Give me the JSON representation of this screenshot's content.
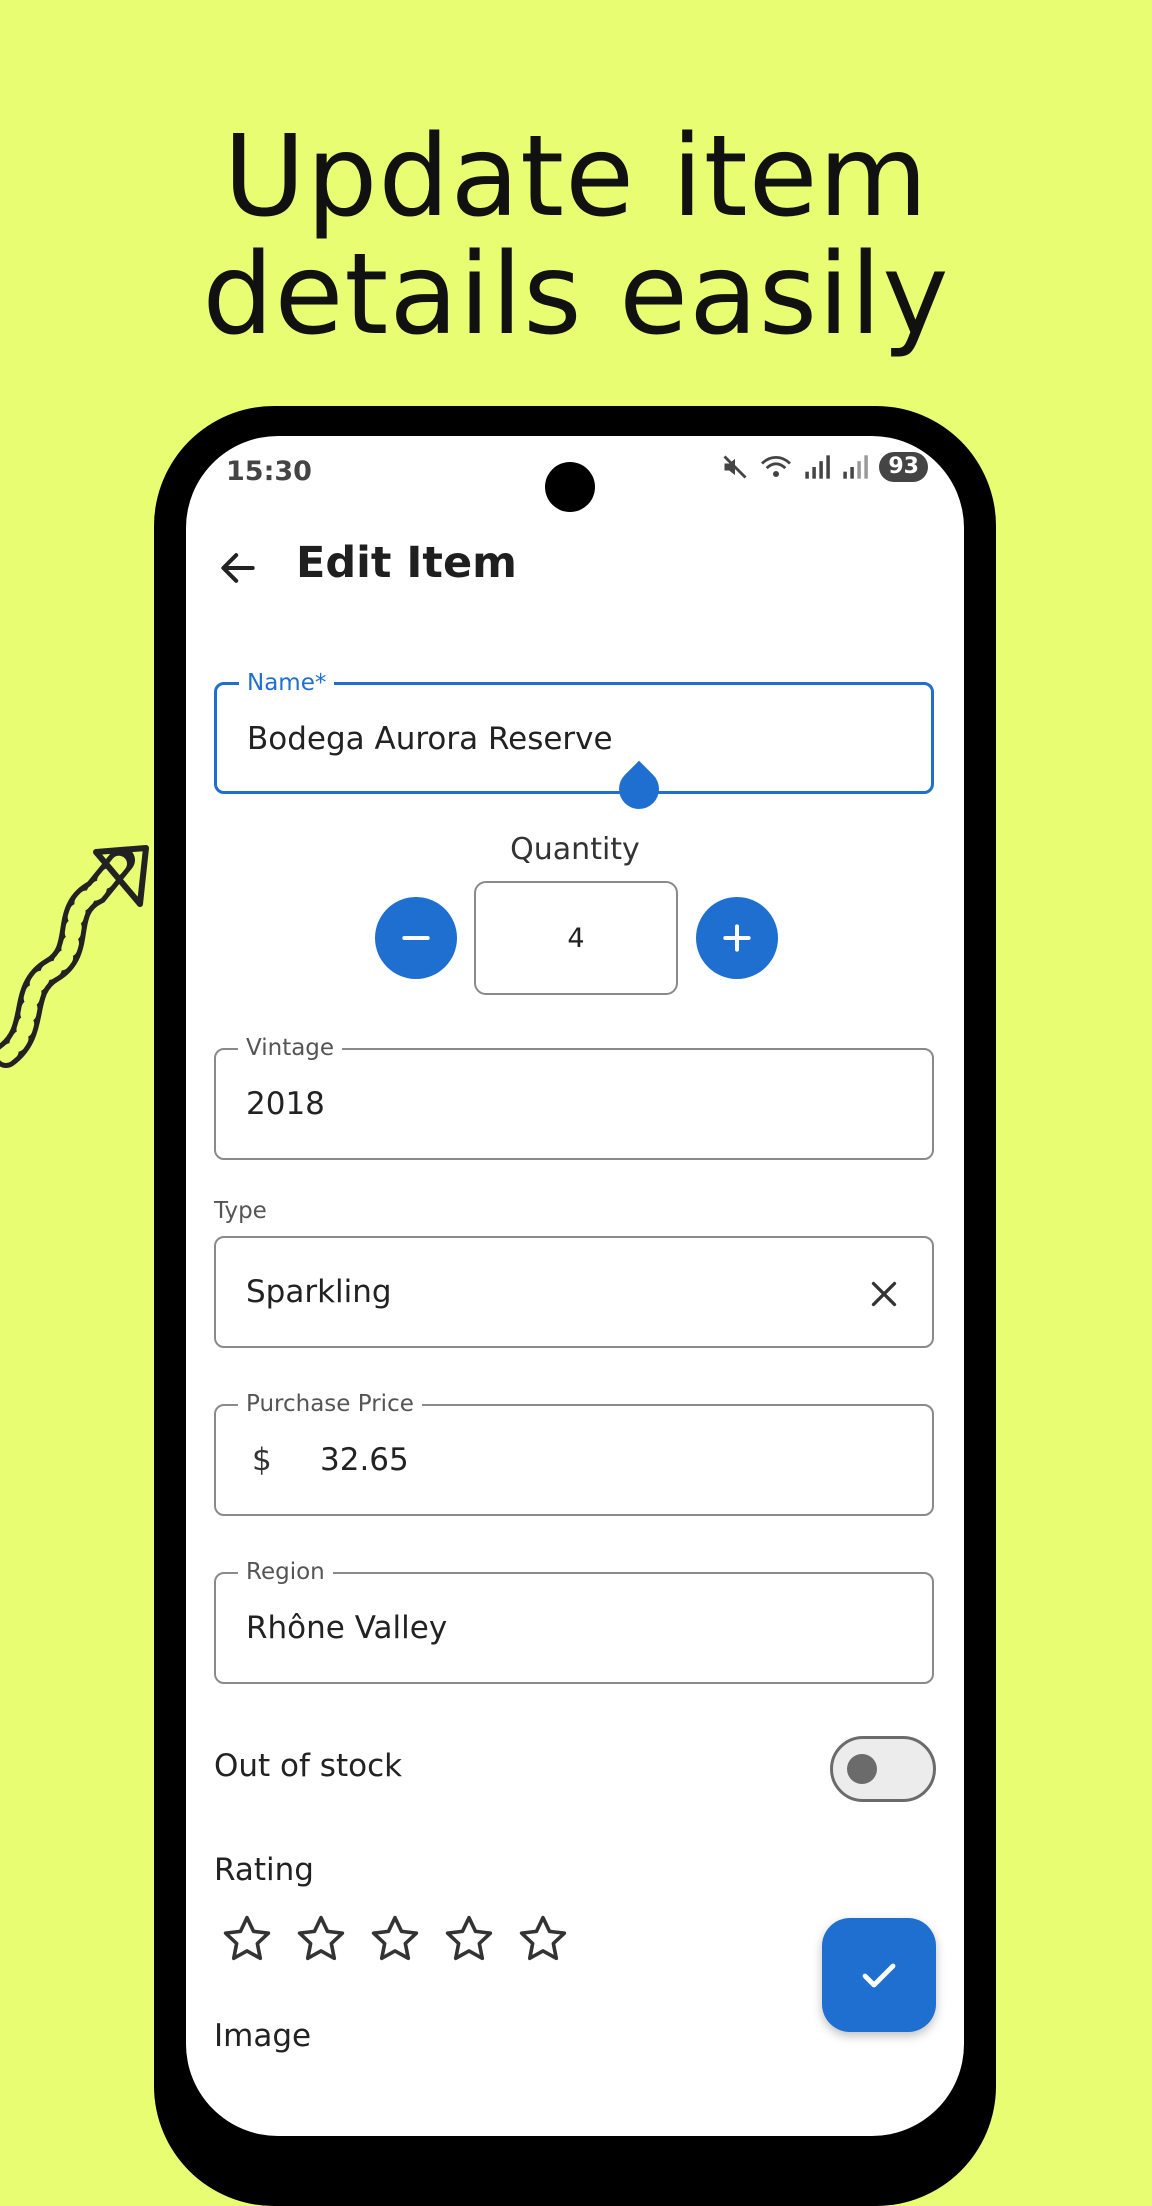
{
  "headline": {
    "line1": "Update item",
    "line2": "details easily"
  },
  "status_bar": {
    "time": "15:30",
    "battery": "93"
  },
  "app_bar": {
    "title": "Edit Item"
  },
  "form": {
    "name": {
      "label": "Name*",
      "value": "Bodega Aurora Reserve"
    },
    "quantity": {
      "label": "Quantity",
      "value": "4"
    },
    "vintage": {
      "label": "Vintage",
      "value": "2018"
    },
    "type": {
      "label": "Type",
      "value": "Sparkling"
    },
    "purchase_price": {
      "label": "Purchase Price",
      "prefix": "$",
      "value": "32.65"
    },
    "region": {
      "label": "Region",
      "value": "Rhône Valley"
    },
    "out_of_stock": {
      "label": "Out of stock",
      "checked": false
    },
    "rating": {
      "label": "Rating",
      "value": 0,
      "max": 5
    },
    "image": {
      "label": "Image"
    }
  },
  "colors": {
    "background": "#e8fd72",
    "accent": "#1e6fd0"
  },
  "icons": {
    "back": "arrow-left-icon",
    "decrement": "minus-icon",
    "increment": "plus-icon",
    "clear": "close-icon",
    "save": "check-icon",
    "rating": "star-outline-icon"
  }
}
